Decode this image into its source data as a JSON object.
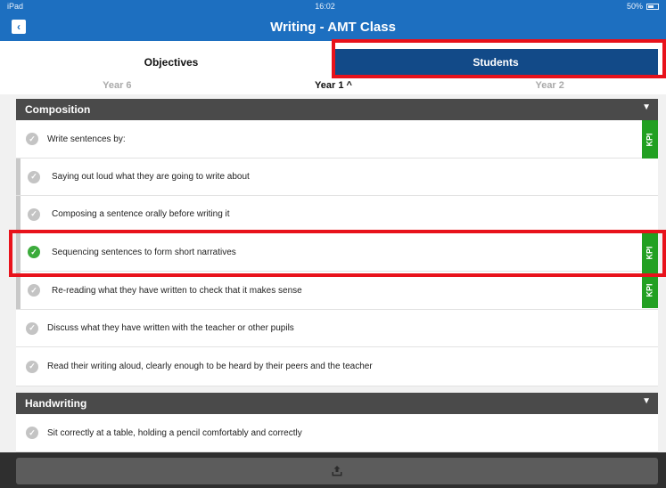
{
  "status": {
    "device": "iPad",
    "time": "16:02",
    "battery": "50%"
  },
  "nav": {
    "title": "Writing - AMT Class",
    "back_glyph": "‹"
  },
  "tabs": [
    {
      "label": "Objectives",
      "active": false
    },
    {
      "label": "Students",
      "active": true
    }
  ],
  "years": {
    "prev": "Year 6",
    "current": "Year 1 ^",
    "next": "Year 2"
  },
  "sections": [
    {
      "title": "Composition",
      "rows": [
        {
          "text": "Write sentences by:",
          "done": false,
          "kpi": true
        },
        {
          "text": "Saying out loud what they are going to write about",
          "done": false,
          "kpi": false
        },
        {
          "text": "Composing a sentence orally before writing it",
          "done": false,
          "kpi": false
        },
        {
          "text": "Sequencing sentences to form short narratives",
          "done": true,
          "kpi": true
        },
        {
          "text": "Re-reading what they have written to check that it makes sense",
          "done": false,
          "kpi": true
        },
        {
          "text": "Discuss what they have written with the teacher or other pupils",
          "done": false,
          "kpi": false
        },
        {
          "text": "Read their writing aloud, clearly enough to be heard by their peers and the teacher",
          "done": false,
          "kpi": false
        }
      ]
    },
    {
      "title": "Handwriting",
      "rows": [
        {
          "text": "Sit correctly at a table, holding a pencil comfortably and correctly",
          "done": false,
          "kpi": false
        }
      ]
    }
  ],
  "kpi_label": "KPI",
  "icons": {
    "check": "check-icon",
    "chevron": "chevron-down-icon",
    "upload": "upload-icon"
  },
  "colors": {
    "brand": "#1d6fc0",
    "tab_active": "#124a88",
    "kpi": "#22a022",
    "done": "#3cab3c",
    "highlight": "#e8121b"
  }
}
